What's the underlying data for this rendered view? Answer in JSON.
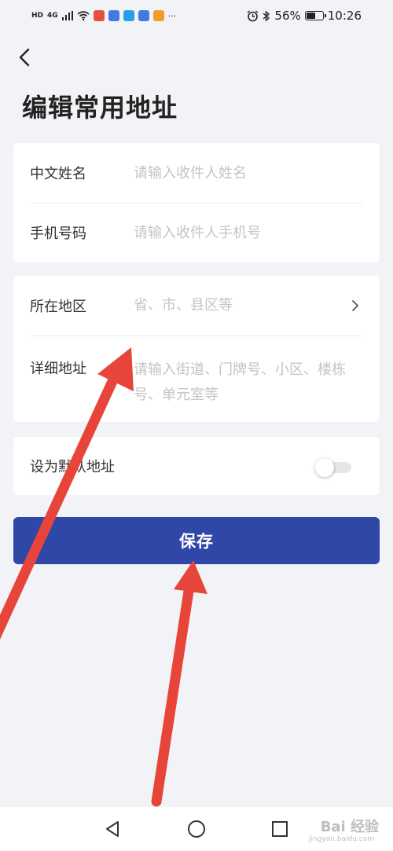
{
  "status_bar": {
    "left_indicator": "HD",
    "network": "4G",
    "more": "···",
    "battery": "56%",
    "time": "10:26"
  },
  "page": {
    "title": "编辑常用地址"
  },
  "form": {
    "name": {
      "label": "中文姓名",
      "placeholder": "请输入收件人姓名"
    },
    "phone": {
      "label": "手机号码",
      "placeholder": "请输入收件人手机号"
    },
    "region": {
      "label": "所在地区",
      "placeholder": "省、市、县区等"
    },
    "detail": {
      "label": "详细地址",
      "placeholder": "请输入街道、门牌号、小区、楼栋号、单元室等"
    },
    "default": {
      "label": "设为默认地址",
      "enabled": false
    }
  },
  "actions": {
    "save_label": "保存"
  },
  "watermark": {
    "text": "Bai 经验",
    "sub": "jingyan.baidu.com"
  },
  "colors": {
    "background": "#f2f3f6",
    "primary": "#2f47a6",
    "annotation_arrow": "#e8453a"
  }
}
